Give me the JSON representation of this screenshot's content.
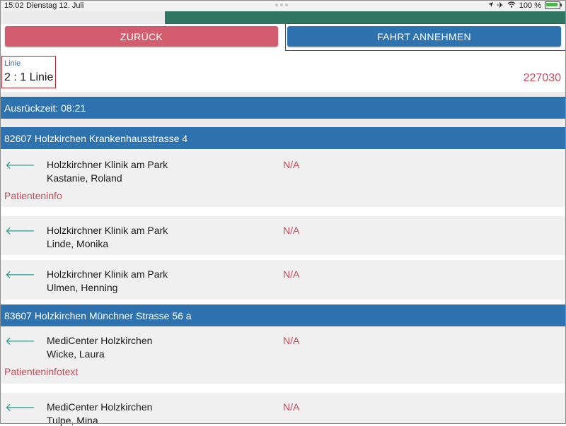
{
  "status_bar": {
    "time": "15:02",
    "date": "Dienstag 12. Juli",
    "battery": "100 %",
    "location_icon": "location-arrow-icon",
    "airplane_icon": "airplane-icon",
    "wifi_icon": "wifi-icon",
    "battery_icon": "battery-charging-icon"
  },
  "toolbar": {
    "back_label": "ZURÜCK",
    "accept_label": "FAHRT ANNEHMEN",
    "back_color": "#d35d6e",
    "accept_color": "#2f72b0"
  },
  "line": {
    "label": "Linie",
    "value": "2 : 1 Linie",
    "trip_number": "227030"
  },
  "departure": {
    "label": "Ausrückzeit: 08:21"
  },
  "stops": [
    {
      "address": "82607 Holzkirchen Krankenhausstrasse 4",
      "entries": [
        {
          "arrow_icon": "arrow-left-icon",
          "place": "Holzkirchner Klinik am Park",
          "patient": "Kastanie, Roland",
          "status": "N/A",
          "info": "Patienteninfo"
        },
        {
          "arrow_icon": "arrow-left-icon",
          "place": "Holzkirchner Klinik am Park",
          "patient": "Linde, Monika",
          "status": "N/A"
        },
        {
          "arrow_icon": "arrow-left-icon",
          "place": "Holzkirchner Klinik am Park",
          "patient": "Ulmen, Henning",
          "status": "N/A"
        }
      ]
    },
    {
      "address": "83607 Holzkirchen Münchner Strasse 56 a",
      "entries": [
        {
          "arrow_icon": "arrow-left-icon",
          "place": "MediCenter Holzkirchen",
          "patient": "Wicke, Laura",
          "status": "N/A",
          "info": "Patienteninfotext"
        },
        {
          "arrow_icon": "arrow-left-icon",
          "place": "MediCenter Holzkirchen",
          "patient": "Tulpe, Mina",
          "status": "N/A"
        }
      ]
    }
  ],
  "colors": {
    "accent_blue": "#2f72b0",
    "alert_red": "#c94a5a",
    "arrow_teal": "#2a9d8f"
  }
}
